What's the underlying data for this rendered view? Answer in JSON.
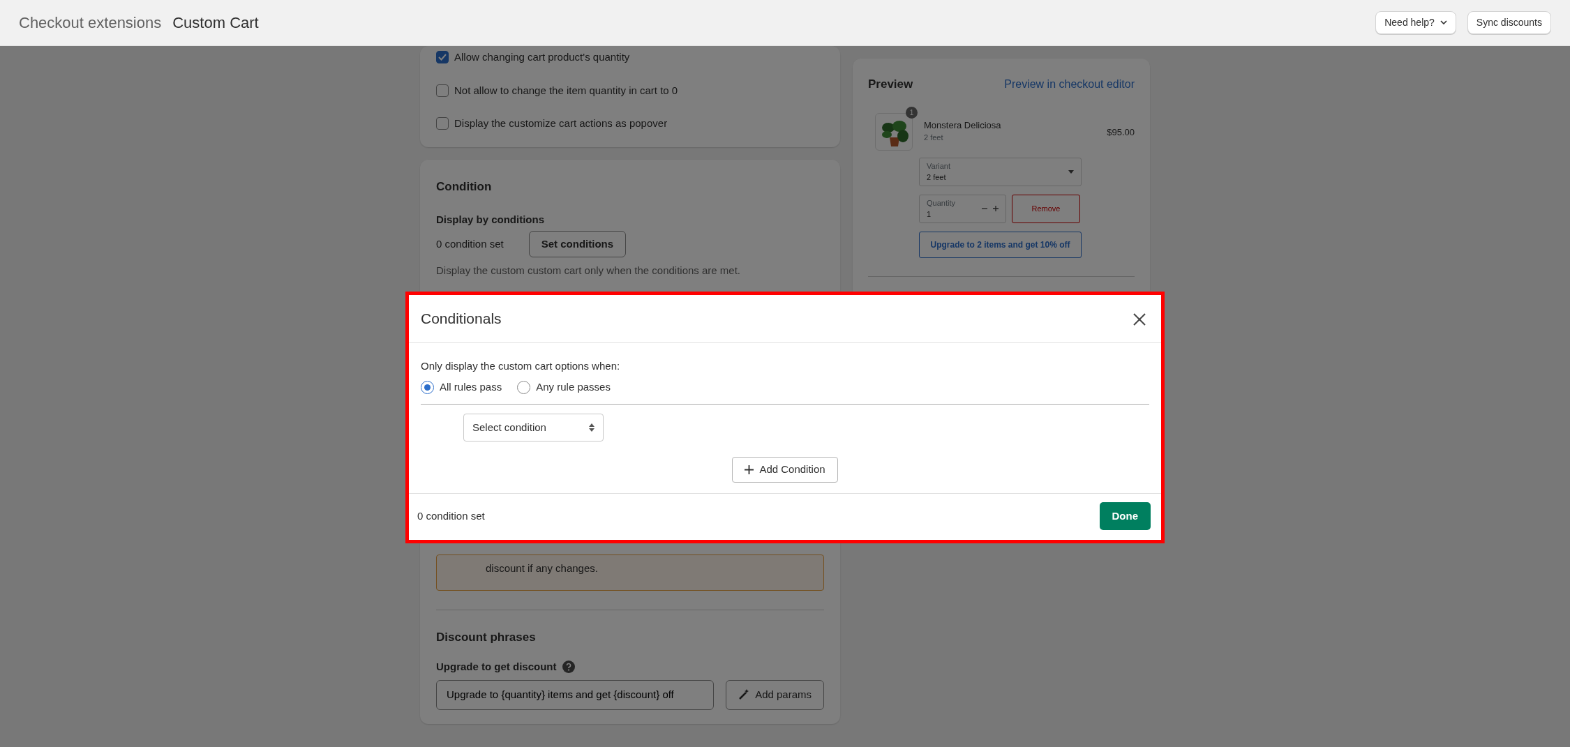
{
  "header": {
    "breadcrumb": "Checkout extensions",
    "title": "Custom Cart",
    "buttons": [
      {
        "label": "Need help?",
        "kind": "dropdown"
      },
      {
        "label": "Sync discounts",
        "kind": "plain"
      }
    ]
  },
  "settings_card": {
    "options": [
      {
        "label": "Allow changing cart product's quantity",
        "checked": true
      },
      {
        "label": "Not allow to change the item quantity in cart to 0",
        "checked": false
      },
      {
        "label": "Display the customize cart actions as popover",
        "checked": false
      }
    ]
  },
  "condition_card": {
    "title": "Condition",
    "label": "Display by conditions",
    "count": "0 condition set",
    "button": "Set conditions",
    "help": "Display the custom custom cart only when the conditions are met.",
    "warning": "discount if any changes.",
    "section_title": "Discount phrases",
    "field_label": "Upgrade to get discount",
    "field_value": "Upgrade to {quantity} items and get {discount} off",
    "params_button": "Add params"
  },
  "preview": {
    "title": "Preview",
    "link": "Preview in checkout editor",
    "product": {
      "badge": "1",
      "name": "Monstera Deliciosa",
      "variant": "2 feet",
      "price": "$95.00"
    },
    "variant_select": {
      "label": "Variant",
      "value": "2 feet"
    },
    "quantity": {
      "label": "Quantity",
      "value": "1"
    },
    "remove": "Remove",
    "upgrade": "Upgrade to 2 items and get 10% off"
  },
  "modal": {
    "title": "Conditionals",
    "prompt": "Only display the custom cart options when:",
    "match_options": [
      {
        "label": "All rules pass",
        "selected": true
      },
      {
        "label": "Any rule passes",
        "selected": false
      }
    ],
    "select": {
      "placeholder": "Select condition"
    },
    "add_button": "Add Condition",
    "footer_count": "0 condition set",
    "done": "Done"
  }
}
